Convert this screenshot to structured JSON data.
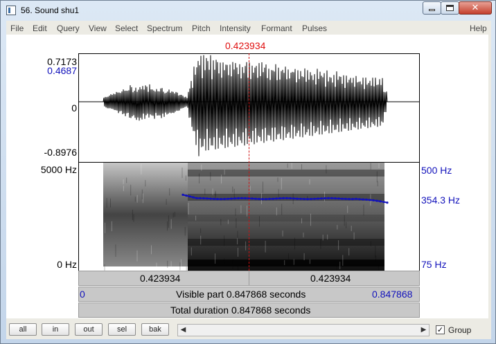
{
  "window": {
    "title": "56. Sound shu1",
    "minimize_icon": "minimize-icon",
    "maximize_icon": "maximize-icon",
    "close_glyph": "✕"
  },
  "menubar": {
    "items": [
      "File",
      "Edit",
      "Query",
      "View",
      "Select",
      "Spectrum",
      "Pitch",
      "Intensity",
      "Formant",
      "Pulses"
    ],
    "help": "Help"
  },
  "cursor": {
    "time": "0.423934"
  },
  "waveform": {
    "max_label": "0.7173",
    "cursor_value_label": "0.4687",
    "zero_label": "0",
    "min_label": "-0.8976"
  },
  "spectrogram": {
    "top_label": "5000 Hz",
    "bottom_label": "0 Hz",
    "pitch_top_label": "500 Hz",
    "pitch_value_label": "354.3 Hz",
    "pitch_bottom_label": "75 Hz"
  },
  "time_bar": {
    "left_segment": "0.423934",
    "right_segment": "0.423934"
  },
  "visible_bar": {
    "start": "0",
    "label": "Visible part 0.847868 seconds",
    "end": "0.847868"
  },
  "total_bar": {
    "label": "Total duration 0.847868 seconds"
  },
  "buttons": {
    "all": "all",
    "in": "in",
    "out": "out",
    "sel": "sel",
    "bak": "bak"
  },
  "scroll": {
    "left_arrow": "◀",
    "right_arrow": "▶"
  },
  "group": {
    "label": "Group",
    "checked_glyph": "✓"
  },
  "colors": {
    "cursor": "#e01010",
    "pitch": "#1111bb",
    "waveform": "#000000"
  }
}
